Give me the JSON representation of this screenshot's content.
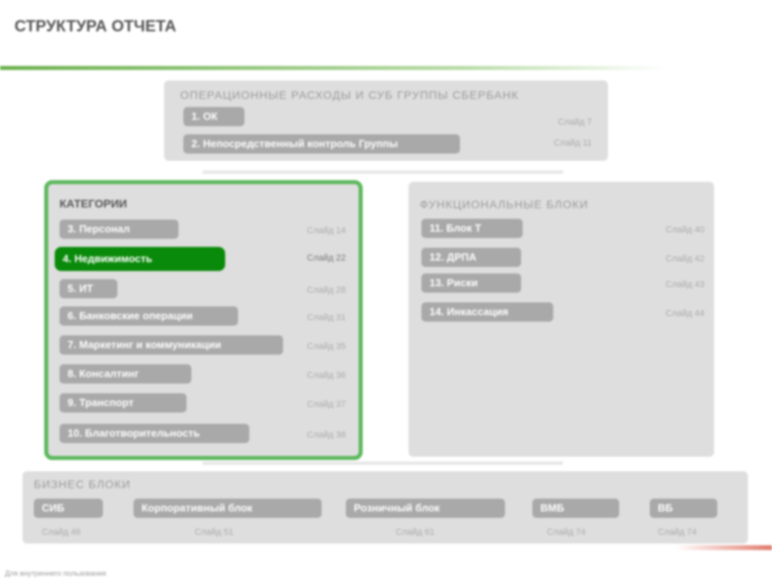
{
  "title": "СТРУКТУРА ОТЧЕТА",
  "top": {
    "header": "ОПЕРАЦИОННЫЕ РАСХОДЫ И СУБ ГРУППЫ СБЕРБАНК",
    "items": [
      {
        "label": "1. ОК",
        "slide": "Слайд 7"
      },
      {
        "label": "2. Непосредственный контроль Группы",
        "slide": "Слайд 11"
      }
    ]
  },
  "categories": {
    "header": "КАТЕГОРИИ",
    "items": [
      {
        "label": "3. Персонал",
        "slide": "Слайд 14"
      },
      {
        "label": "4. Недвижимость",
        "slide": "Слайд 22"
      },
      {
        "label": "5. ИТ",
        "slide": "Слайд 28"
      },
      {
        "label": "6. Банковские операции",
        "slide": "Слайд 31"
      },
      {
        "label": "7. Маркетинг и коммуникации",
        "slide": "Слайд 35"
      },
      {
        "label": "8. Консалтинг",
        "slide": "Слайд 36"
      },
      {
        "label": "9. Транспорт",
        "slide": "Слайд 37"
      },
      {
        "label": "10. Благотворительность",
        "slide": "Слайд 38"
      }
    ]
  },
  "functional": {
    "header": "ФУНКЦИОНАЛЬНЫЕ БЛОКИ",
    "items": [
      {
        "label": "11. Блок Т",
        "slide": "Слайд 40"
      },
      {
        "label": "12. ДРПА",
        "slide": "Слайд 42"
      },
      {
        "label": "13. Риски",
        "slide": "Слайд 43"
      },
      {
        "label": "14. Инкассация",
        "slide": "Слайд 44"
      }
    ]
  },
  "business": {
    "header": "БИЗНЕС БЛОКИ",
    "items": [
      {
        "label": "СИБ",
        "slide": "Слайд 46"
      },
      {
        "label": "Корпоративный блок",
        "slide": "Слайд 51"
      },
      {
        "label": "Розничный блок",
        "slide": "Слайд 61"
      },
      {
        "label": "ВМБ",
        "slide": "Слайд 74"
      },
      {
        "label": "ВБ",
        "slide": "Слайд 74"
      }
    ]
  },
  "footer": "Для внутреннего пользования",
  "colors": {
    "accent": "#0a8a0a",
    "frame": "#5cb85c",
    "pill": "#a9a9a9",
    "box": "#dedede"
  }
}
